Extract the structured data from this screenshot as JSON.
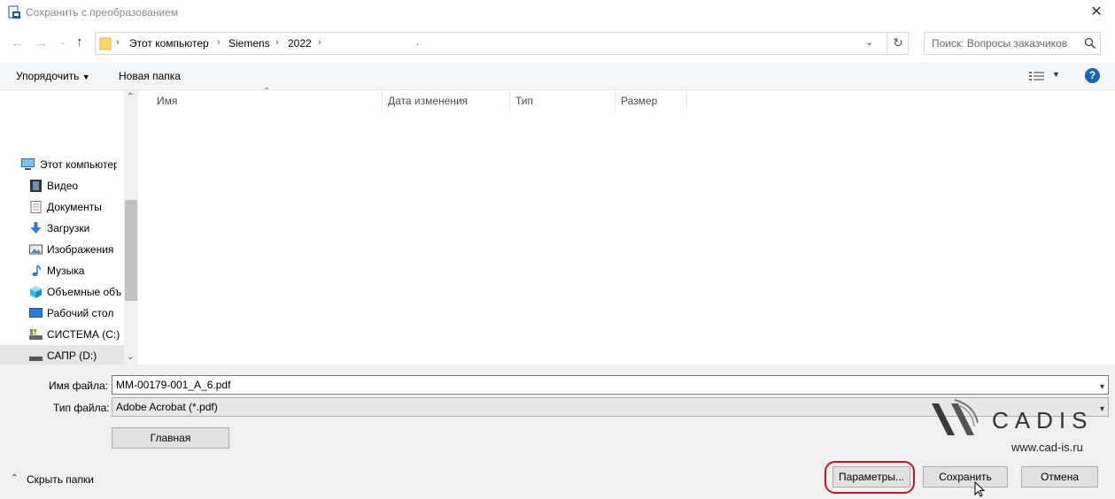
{
  "window": {
    "title": "Сохранить с преобразованием"
  },
  "address": {
    "crumbs": [
      "Этот компьютер",
      "Siemens",
      "2022"
    ],
    "extra": "."
  },
  "search": {
    "placeholder": "Поиск: Вопросы заказчиков"
  },
  "toolbar": {
    "organize_label": "Упорядочить",
    "new_folder_label": "Новая папка",
    "help_label": "?"
  },
  "columns": [
    "Имя",
    "Дата изменения",
    "Тип",
    "Размер"
  ],
  "nav_tree": {
    "root": "Этот компьютер",
    "items": [
      "Видео",
      "Документы",
      "Загрузки",
      "Изображения",
      "Музыка",
      "Объемные объ",
      "Рабочий стол",
      "СИСТЕМА (C:)",
      "САПР (D:)"
    ]
  },
  "form": {
    "filename_label": "Имя файла:",
    "filename_value": "MM-00179-001_A_6.pdf",
    "filetype_label": "Тип файла:",
    "filetype_value": "Adobe Acrobat (*.pdf)",
    "main_button": "Главная"
  },
  "footer": {
    "hide_folders": "Скрыть папки",
    "params_button": "Параметры...",
    "save_button": "Сохранить",
    "cancel_button": "Отмена"
  },
  "brand": {
    "name": "CADIS",
    "url": "www.cad-is.ru"
  },
  "colors": {
    "highlight_circle": "#c8102e",
    "help_blue": "#1a62b5"
  }
}
